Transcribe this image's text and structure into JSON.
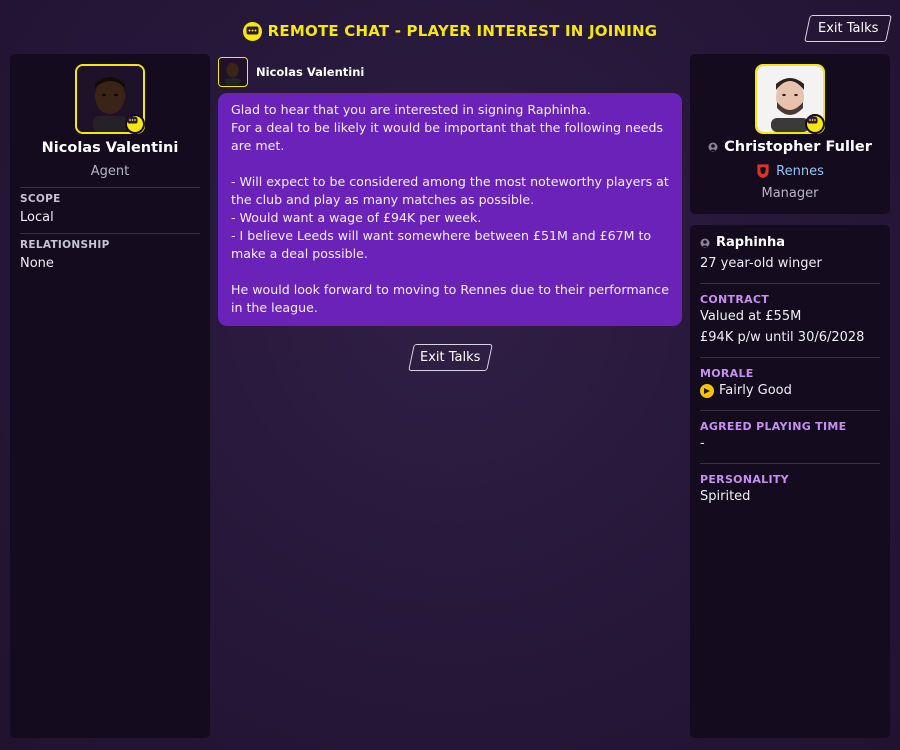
{
  "header": {
    "title": "REMOTE CHAT - PLAYER INTEREST IN JOINING",
    "exit_label": "Exit Talks"
  },
  "agent": {
    "name": "Nicolas Valentini",
    "role": "Agent",
    "scope_label": "SCOPE",
    "scope_value": "Local",
    "relationship_label": "RELATIONSHIP",
    "relationship_value": "None"
  },
  "message": {
    "sender": "Nicolas Valentini",
    "lines": [
      "Glad to hear that you are interested in signing Raphinha.",
      "For a deal to be likely it would be important that the following needs are met.",
      "",
      "- Will expect to be considered among the most noteworthy players at the club and play as many matches as possible.",
      "- Would want a wage of £94K per week.",
      "- I believe Leeds will want somewhere between £51M and £67M to make a deal possible.",
      "",
      "He would look forward to moving to Rennes due to their performance in the league."
    ],
    "exit_label": "Exit Talks"
  },
  "manager": {
    "name": "Christopher Fuller",
    "club": "Rennes",
    "role": "Manager"
  },
  "player": {
    "name": "Raphinha",
    "description": "27 year-old winger",
    "contract_label": "CONTRACT",
    "contract_value": "Valued at £55M",
    "contract_wage": "£94K p/w until 30/6/2028",
    "morale_label": "MORALE",
    "morale_value": "Fairly Good",
    "playing_time_label": "AGREED PLAYING TIME",
    "playing_time_value": "-",
    "personality_label": "PERSONALITY",
    "personality_value": "Spirited"
  },
  "colors": {
    "accent_yellow": "#f5e80a",
    "bubble_purple": "#6a22b8",
    "label_lilac": "#c690f0",
    "club_blue": "#8ec8f0"
  }
}
